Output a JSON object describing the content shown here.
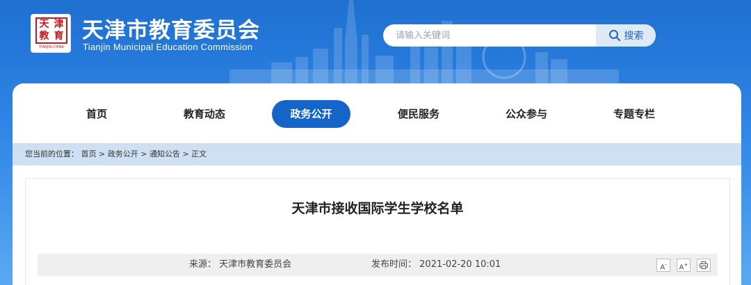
{
  "header": {
    "seal_chars": [
      "天",
      "津",
      "教",
      "育"
    ],
    "seal_subtitle": "TIANJIN·CHINA",
    "title": "天津市教育委员会",
    "subtitle": "Tianjin Municipal Education Commission",
    "search_placeholder": "请输入关键词",
    "search_button": "搜索"
  },
  "nav": {
    "items": [
      "首页",
      "教育动态",
      "政务公开",
      "便民服务",
      "公众参与",
      "专题专栏"
    ],
    "active": "政务公开"
  },
  "breadcrumb": {
    "prefix": "您当前的位置：",
    "items": [
      "首页",
      "政务公开",
      "通知公告",
      "正文"
    ],
    "separator": ">"
  },
  "article": {
    "title": "天津市接收国际学生学校名单",
    "source_label": "来源：",
    "source": "天津市教育委员会",
    "time_label": "发布时间：",
    "time": "2021-02-20 10:01",
    "tools": [
      "A-",
      "A+",
      "print"
    ]
  },
  "colors": {
    "brand_blue": "#1565c8",
    "seal_red": "#c8161d",
    "breadcrumb_bg": "#cfe0f2"
  }
}
